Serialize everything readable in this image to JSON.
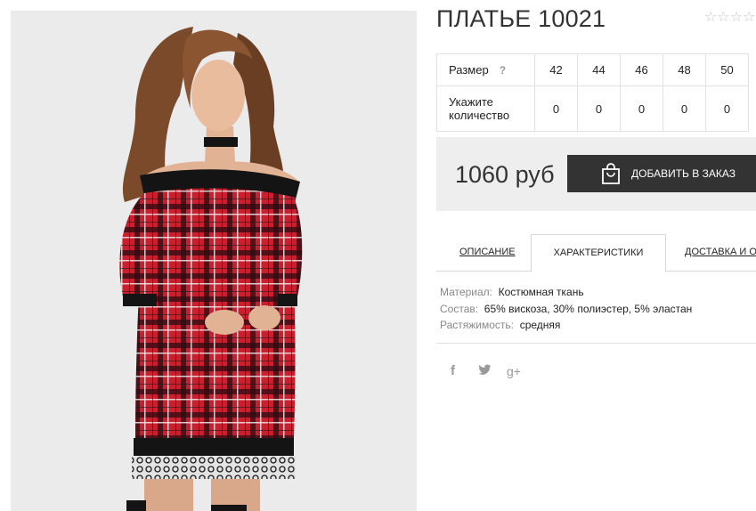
{
  "product": {
    "title": "ПЛАТЬЕ 10021",
    "rating_stars": "☆☆☆☆"
  },
  "size_table": {
    "size_label": "Размер",
    "help_mark": "?",
    "sizes": [
      "42",
      "44",
      "46",
      "48",
      "50"
    ],
    "quantity_label_line1": "Укажите",
    "quantity_label_line2": "количество",
    "quantities": [
      "0",
      "0",
      "0",
      "0",
      "0"
    ]
  },
  "purchase": {
    "price": "1060 руб",
    "add_button_label": "ДОБАВИТЬ В ЗАКАЗ"
  },
  "tabs": {
    "description": "ОПИСАНИЕ",
    "characteristics": "ХАРАКТЕРИСТИКИ",
    "delivery": "ДОСТАВКА И ОПЛАТА"
  },
  "specs": [
    {
      "label": "Материал:",
      "value": "Костюмная ткань"
    },
    {
      "label": "Состав:",
      "value": "65% вискоза, 30% полиэстер, 5% эластан"
    },
    {
      "label": "Растяжимость:",
      "value": "средняя"
    }
  ],
  "social": {
    "facebook": "f",
    "twitter_icon": "twitter-icon",
    "googleplus": "g+"
  },
  "colors": {
    "button_bg": "#333333",
    "buybox_bg": "#eeeeee",
    "dress_red": "#c8202e",
    "trim_black": "#141414"
  }
}
